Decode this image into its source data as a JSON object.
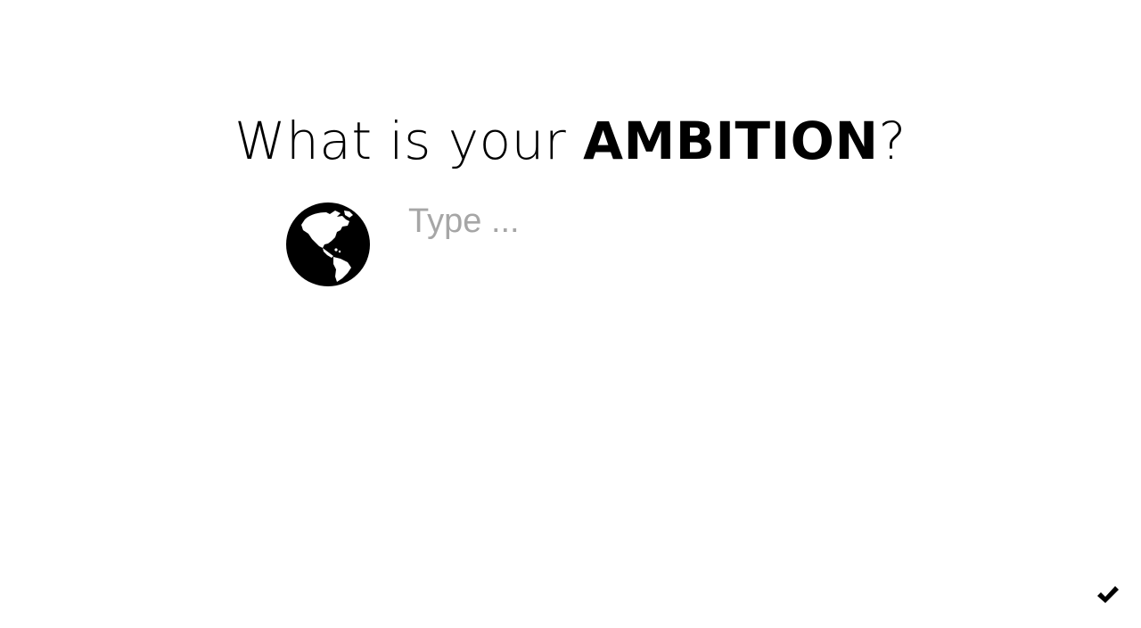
{
  "prompt": {
    "prefix": "What is your ",
    "emphasis": "AMBITION",
    "suffix": "?"
  },
  "answer": {
    "placeholder": "Type ...",
    "value": ""
  },
  "icons": {
    "left": "globe-icon",
    "submit": "checkmark-icon"
  },
  "colors": {
    "text": "#000000",
    "placeholder": "#a6a6a6",
    "background": "#ffffff"
  }
}
